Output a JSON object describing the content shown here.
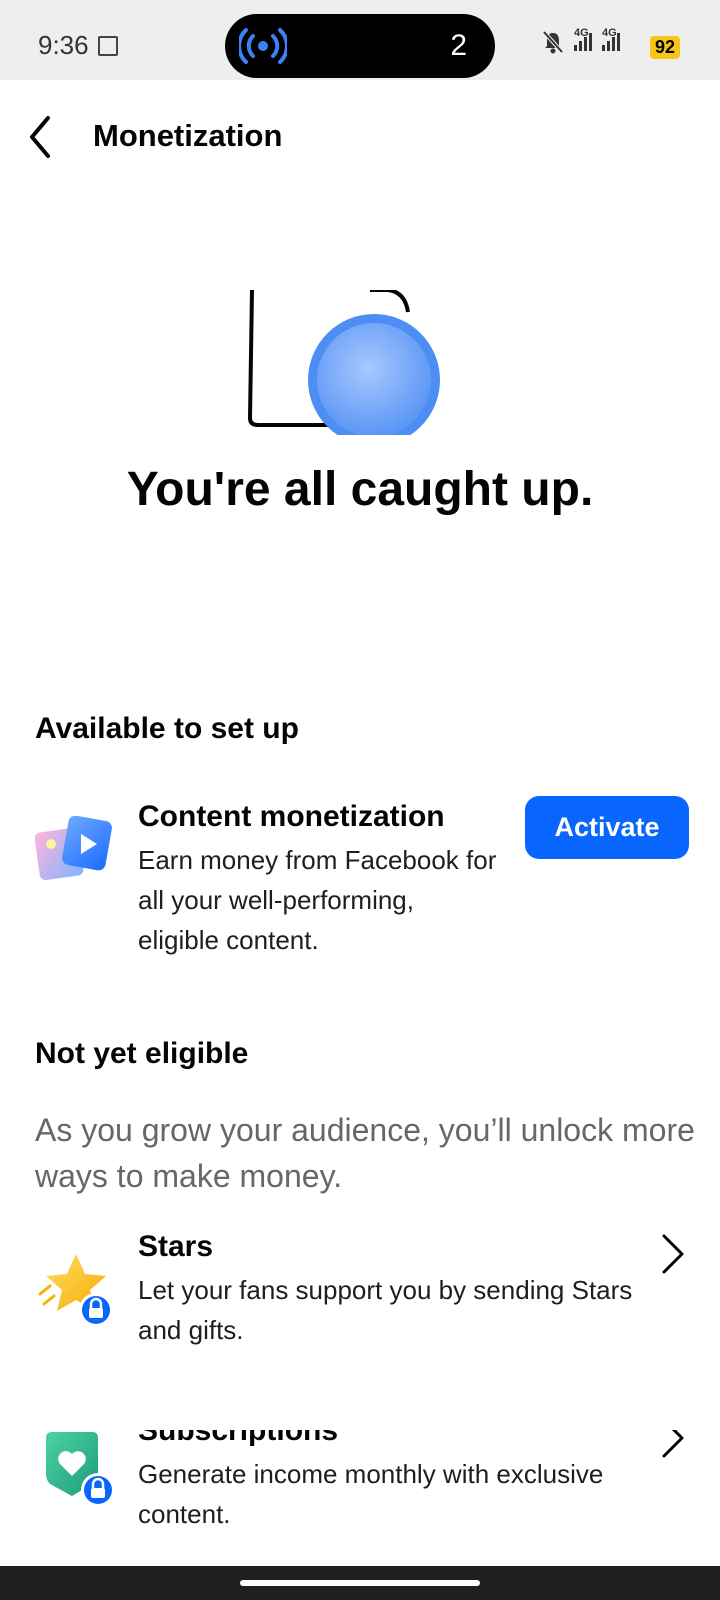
{
  "status": {
    "time": "9:36",
    "live_count": "2",
    "net1": "4G",
    "net2": "4G",
    "battery": "92"
  },
  "header": {
    "title": "Monetization"
  },
  "hero": {
    "title": "You're all caught up."
  },
  "available": {
    "title": "Available to set up",
    "items": [
      {
        "title": "Content monetization",
        "desc": "Earn money from Facebook for all your well-performing, eligible content.",
        "button": "Activate"
      }
    ]
  },
  "not_eligible": {
    "title": "Not yet eligible",
    "desc": "As you grow your audience, you’ll unlock more ways to make money.",
    "items": [
      {
        "title": "Stars",
        "desc": "Let your fans support you by sending Stars and gifts."
      },
      {
        "title": "Subscriptions",
        "desc": "Generate income monthly with exclusive content."
      }
    ]
  },
  "colors": {
    "accent": "#0866ff",
    "muted_text": "#65676b"
  }
}
